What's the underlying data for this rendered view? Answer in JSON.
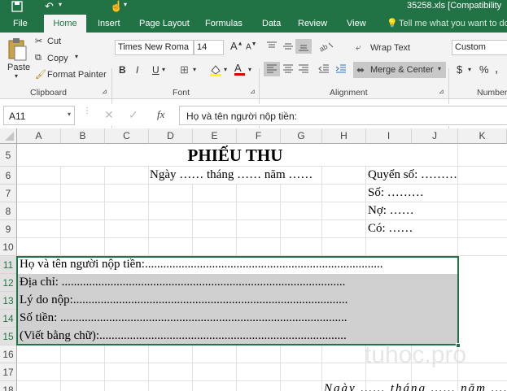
{
  "title_bar": {
    "filename": "35258.xls [Compatibility"
  },
  "tabs": [
    "File",
    "Home",
    "Insert",
    "Page Layout",
    "Formulas",
    "Data",
    "Review",
    "View"
  ],
  "tell_me": "Tell me what you want to do",
  "clipboard": {
    "paste": "Paste",
    "cut": "Cut",
    "copy": "Copy",
    "format_painter": "Format Painter",
    "group": "Clipboard"
  },
  "font": {
    "name": "Times New Roma",
    "size": "14",
    "bold": "B",
    "italic": "I",
    "underline": "U",
    "group": "Font"
  },
  "alignment": {
    "wrap": "Wrap Text",
    "merge": "Merge & Center",
    "group": "Alignment"
  },
  "number": {
    "format": "Custom",
    "currency": "$",
    "percent": "%",
    "group": "Number"
  },
  "formula_bar": {
    "name_box": "A11",
    "fx": "fx",
    "content": "Họ và tên người nộp tiền:"
  },
  "columns": [
    "A",
    "B",
    "C",
    "D",
    "E",
    "F",
    "G",
    "H",
    "I",
    "J",
    "K"
  ],
  "rows": [
    "5",
    "6",
    "7",
    "8",
    "9",
    "10",
    "11",
    "12",
    "13",
    "14",
    "15",
    "16",
    "17",
    "18"
  ],
  "sheet": {
    "title": "PHIẾU THU",
    "date_line": "Ngày …… tháng …… năm ……",
    "quyen_so": "Quyển số: ………",
    "so": "Số: ………",
    "no": "Nợ: ……",
    "co": "Có: ……",
    "ho_ten": "Họ và tên người nộp tiền:..............................................................................",
    "dia_chi": "Địa chỉ: .............................................................................................",
    "ly_do": "Lý do nộp:..........................................................................................",
    "so_tien": "Số tiền: ..............................................................................................",
    "viet_bang_chu": "(Viết bằng chữ):.................................................................................",
    "footer_date": "Ngày …… tháng …… năm ……"
  },
  "watermark": "tuhoc.pro",
  "colors": {
    "ribbon_green": "#217346",
    "selection_border": "#217346",
    "band_gray": "#d0d0d0"
  }
}
